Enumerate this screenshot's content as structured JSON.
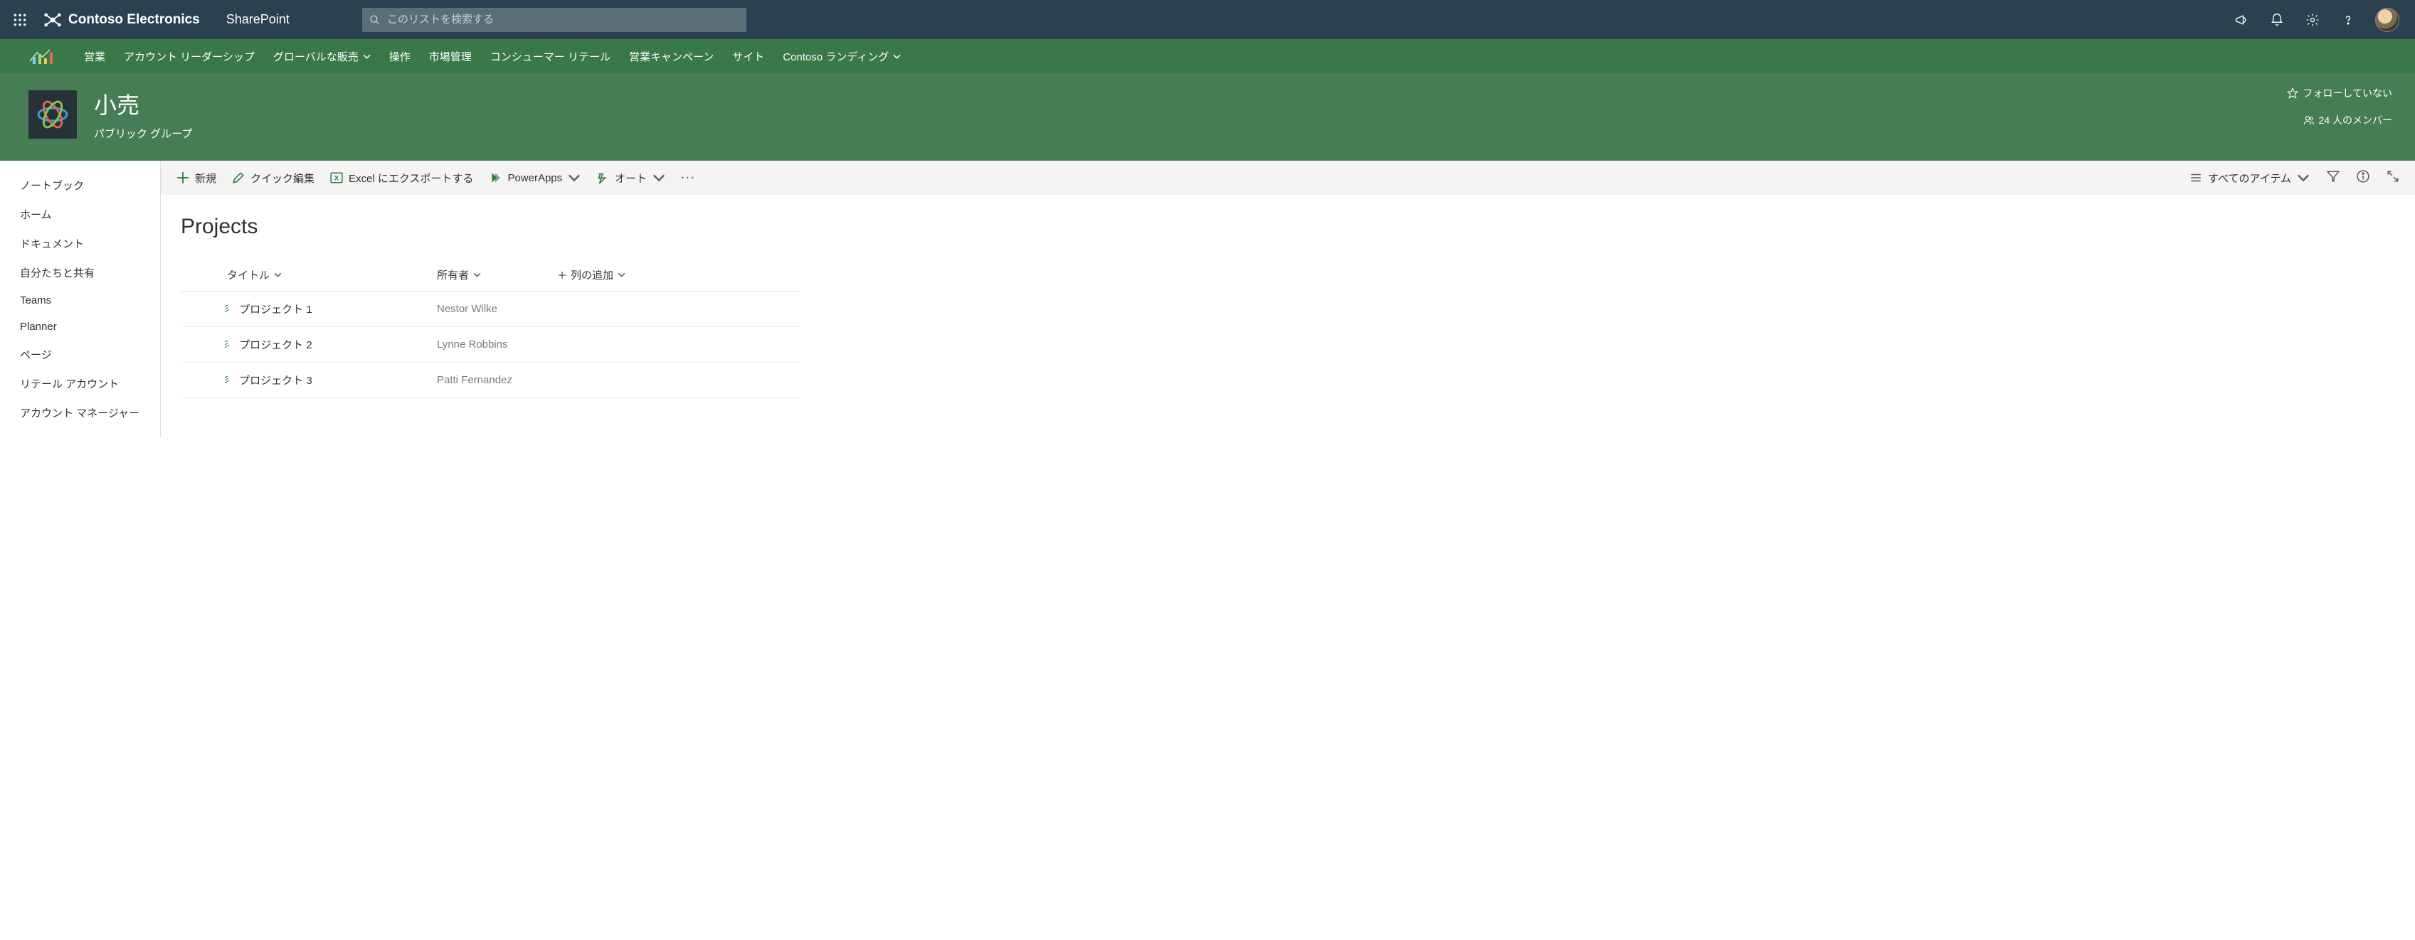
{
  "appbar": {
    "brand_name": "Contoso Electronics",
    "product": "SharePoint",
    "search_placeholder": "このリストを検索する"
  },
  "hubnav": {
    "items": [
      {
        "label": "営業",
        "has_chevron": false
      },
      {
        "label": "アカウント リーダーシップ",
        "has_chevron": false
      },
      {
        "label": "グローバルな販売",
        "has_chevron": true
      },
      {
        "label": "操作",
        "has_chevron": false
      },
      {
        "label": "市場管理",
        "has_chevron": false
      },
      {
        "label": "コンシューマー リテール",
        "has_chevron": false
      },
      {
        "label": "営業キャンペーン",
        "has_chevron": false
      },
      {
        "label": "サイト",
        "has_chevron": false
      },
      {
        "label": "Contoso ランディング",
        "has_chevron": true
      }
    ]
  },
  "site": {
    "title": "小売",
    "subtitle": "パブリック グループ",
    "follow": "フォローしていない",
    "members": "24 人のメンバー"
  },
  "leftnav": {
    "items": [
      "ノートブック",
      "ホーム",
      "ドキュメント",
      "自分たちと共有",
      "Teams",
      "Planner",
      "ページ",
      "リテール アカウント",
      "アカウント マネージャー"
    ]
  },
  "cmdbar": {
    "new": "新規",
    "quick_edit": "クイック編集",
    "export_excel": "Excel にエクスポートする",
    "powerapps": "PowerApps",
    "automate": "オート",
    "view_label": "すべてのアイテム"
  },
  "list": {
    "title": "Projects",
    "columns": {
      "title": "タイトル",
      "owner": "所有者",
      "add_column": "列の追加"
    },
    "rows": [
      {
        "title": "プロジェクト 1",
        "owner": "Nestor Wilke"
      },
      {
        "title": "プロジェクト 2",
        "owner": "Lynne Robbins"
      },
      {
        "title": "プロジェクト 3",
        "owner": "Patti Fernandez"
      }
    ]
  }
}
